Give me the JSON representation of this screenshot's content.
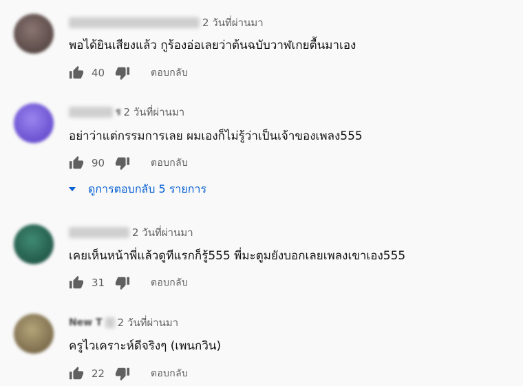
{
  "comments": [
    {
      "time": "2 วันที่ผ่านมา",
      "text": "พอได้ยินเสียงแล้ว กูร้องอ่อเลยว่าต้นฉบับวาฬเกยตื้นมาเอง",
      "likes": "40",
      "reply_label": "ตอบกลับ",
      "avatar_color": "#6b5a55"
    },
    {
      "author_partial": "ร",
      "time": "2 วันที่ผ่านมา",
      "text": "อย่าว่าแต่กรรมการเลย ผมเองก็ไม่รู้ว่าเป็นเจ้าของเพลง555",
      "likes": "90",
      "reply_label": "ตอบกลับ",
      "avatar_color": "#7b62d8",
      "replies_label": "ดูการตอบกลับ 5 รายการ"
    },
    {
      "time": "2 วันที่ผ่านมา",
      "text": "เคยเห็นหน้าพี่แล้วดูทีแรกก็รู้555 พี่มะตูมยังบอกเลยเพลงเขาเอง555",
      "likes": "31",
      "reply_label": "ตอบกลับ",
      "avatar_color": "#2e6b5a"
    },
    {
      "author_partial": "New T",
      "time": "2 วันที่ผ่านมา",
      "text": "ครูไวเคราะห์ดีจริงๆ (เพนกวิน)",
      "likes": "22",
      "reply_label": "ตอบกลับ",
      "avatar_color": "#9a8a62"
    }
  ],
  "icons": {
    "like": "thumbs-up-icon",
    "dislike": "thumbs-down-icon",
    "expand": "caret-down-icon"
  },
  "colors": {
    "link": "#065fd4",
    "secondary_text": "#606060",
    "background": "#f9f9f9"
  }
}
